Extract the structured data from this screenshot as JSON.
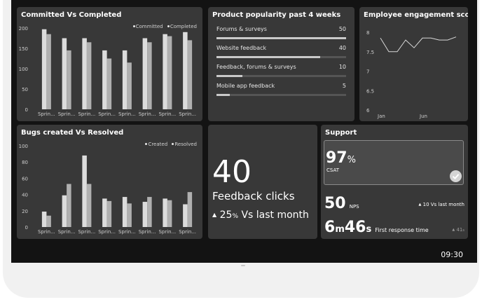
{
  "clock": "09:30",
  "committed_panel": {
    "title": "Committed Vs Completed",
    "legend": [
      "Committed",
      "Completed"
    ]
  },
  "bugs_panel": {
    "title": "Bugs created Vs Resolved",
    "legend": [
      "Created",
      "Resolved"
    ]
  },
  "popularity": {
    "title": "Product popularity past 4 weeks",
    "items": [
      {
        "label": "Forums & surveys",
        "value": "50",
        "fraction": 1.0
      },
      {
        "label": "Website feedback",
        "value": "40",
        "fraction": 0.8
      },
      {
        "label": "Feedback, forums & surveys",
        "value": "10",
        "fraction": 0.2
      },
      {
        "label": "Mobile app feedback",
        "value": "5",
        "fraction": 0.1
      }
    ]
  },
  "engagement": {
    "title": "Employee engagement score"
  },
  "feedback": {
    "number": "40",
    "label": "Feedback clicks",
    "change_value": "25",
    "change_unit": "%",
    "change_label": "Vs last month"
  },
  "support": {
    "title": "Support",
    "csat_value": "97",
    "csat_unit": "%",
    "csat_label": "CSAT",
    "nps_value": "50",
    "nps_label": "NPS",
    "nps_change": "10 Vs last month",
    "time_m": "6",
    "time_m_unit": "m",
    "time_s": "46",
    "time_s_unit": "s",
    "time_label": "First response time",
    "time_change": "41",
    "time_change_unit": "s"
  },
  "colors": {
    "panel": "#383838",
    "bar_primary": "#dcdcdc",
    "bar_secondary": "#b0b0b0",
    "text": "#ffffff"
  },
  "chart_data": [
    {
      "type": "bar",
      "title": "Committed Vs Completed",
      "categories": [
        "Sprin...",
        "Sprin...",
        "Sprin...",
        "Sprin...",
        "Sprin...",
        "Sprin...",
        "Sprin...",
        "Sprin..."
      ],
      "series": [
        {
          "name": "Committed",
          "values": [
            197,
            175,
            175,
            145,
            145,
            175,
            185,
            190
          ]
        },
        {
          "name": "Completed",
          "values": [
            185,
            145,
            165,
            125,
            115,
            165,
            180,
            170
          ]
        }
      ],
      "yticks": [
        0,
        50,
        100,
        150,
        200
      ],
      "ylim": [
        0,
        200
      ],
      "legend": "top-right",
      "grid": false
    },
    {
      "type": "bar",
      "title": "Bugs created Vs Resolved",
      "categories": [
        "Sprin...",
        "Sprin...",
        "Sprin...",
        "Sprin...",
        "Sprin...",
        "Sprin...",
        "Sprin...",
        "Sprin..."
      ],
      "series": [
        {
          "name": "Created",
          "values": [
            19,
            39,
            88,
            35,
            37,
            31,
            35,
            28
          ]
        },
        {
          "name": "Resolved",
          "values": [
            14,
            53,
            53,
            32,
            29,
            37,
            33,
            43
          ]
        }
      ],
      "yticks": [
        0,
        20,
        40,
        60,
        80,
        100
      ],
      "ylim": [
        0,
        100
      ],
      "legend": "top-right",
      "grid": false
    },
    {
      "type": "line",
      "title": "Employee engagement score",
      "x": [
        1,
        2,
        3,
        4,
        5,
        6,
        7,
        8,
        9,
        10
      ],
      "xticks": [
        {
          "at": 1,
          "label": "Jan"
        },
        {
          "at": 6,
          "label": "Jun"
        }
      ],
      "y": [
        7.85,
        7.5,
        7.5,
        7.8,
        7.6,
        7.85,
        7.85,
        7.8,
        7.8,
        7.88
      ],
      "yticks": [
        6,
        6.5,
        7,
        7.5,
        8
      ],
      "ylim": [
        6,
        8
      ],
      "grid": false
    }
  ]
}
